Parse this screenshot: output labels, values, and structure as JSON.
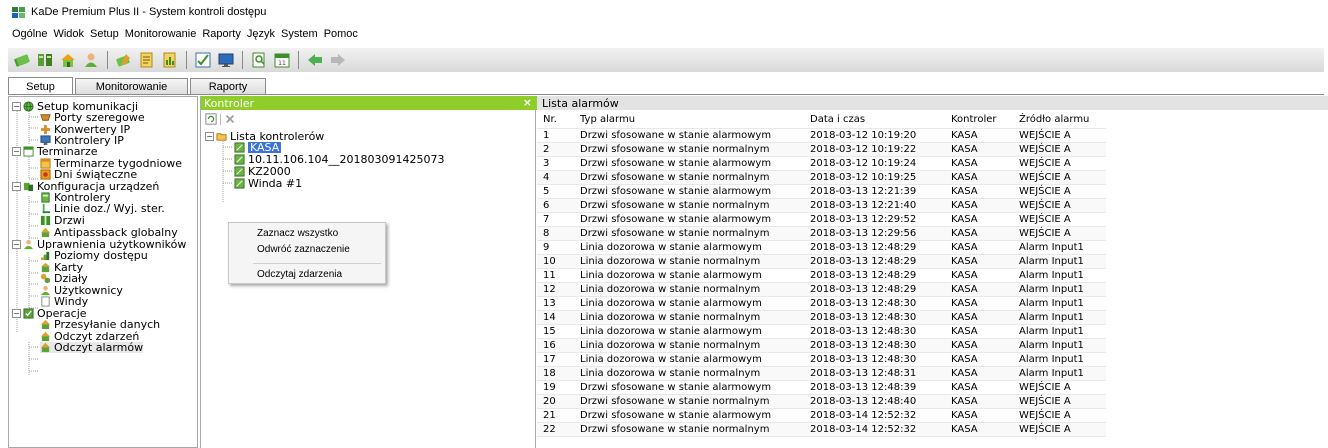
{
  "window": {
    "title": "KaDe Premium Plus II - System kontroli dostępu"
  },
  "menu": [
    "Ogólne",
    "Widok",
    "Setup",
    "Monitorowanie",
    "Raporty",
    "Język",
    "System",
    "Pomoc"
  ],
  "toolbar": {
    "buttons": [
      "cards-icon",
      "controllers-icon",
      "home-icon",
      "user-icon",
      "cards-edit-icon",
      "document-icon",
      "report-icon",
      "checklist-icon",
      "monitor-icon",
      "search-document-icon",
      "calendar-icon",
      "arrow-left-icon",
      "arrow-right-icon"
    ]
  },
  "tabs": [
    "Setup",
    "Monitorowanie",
    "Raporty"
  ],
  "tree": [
    {
      "label": "Setup komunikacji",
      "level": 0,
      "icon": "globe-icon"
    },
    {
      "label": "Porty szeregowe",
      "level": 1,
      "icon": "serial-port-icon"
    },
    {
      "label": "Konwertery IP",
      "level": 1,
      "icon": "converter-icon"
    },
    {
      "label": "Kontrolery IP",
      "level": 1,
      "icon": "ip-controller-icon"
    },
    {
      "label": "Terminarze",
      "level": 0,
      "icon": "schedule-icon"
    },
    {
      "label": "Terminarze tygodniowe",
      "level": 1,
      "icon": "week-calendar-icon"
    },
    {
      "label": "Dni świąteczne",
      "level": 1,
      "icon": "holiday-icon"
    },
    {
      "label": "Konfiguracja urządzeń",
      "level": 0,
      "icon": "devices-icon"
    },
    {
      "label": "Kontrolery",
      "level": 1,
      "icon": "controller-icon"
    },
    {
      "label": "Linie doz./ Wyj. ster.",
      "level": 1,
      "icon": "lines-icon"
    },
    {
      "label": "Drzwi",
      "level": 1,
      "icon": "door-icon"
    },
    {
      "label": "Antipassback globalny",
      "level": 1,
      "icon": "antipassback-icon"
    },
    {
      "label": "Uprawnienia użytkowników",
      "level": 0,
      "icon": "users-icon"
    },
    {
      "label": "Poziomy dostępu",
      "level": 1,
      "icon": "access-level-icon"
    },
    {
      "label": "Karty",
      "level": 1,
      "icon": "card-icon"
    },
    {
      "label": "Działy",
      "level": 1,
      "icon": "departments-icon"
    },
    {
      "label": "Użytkownicy",
      "level": 1,
      "icon": "user-icon"
    },
    {
      "label": "Windy",
      "level": 1,
      "icon": "elevator-icon"
    },
    {
      "label": "Operacje",
      "level": 0,
      "icon": "operations-icon"
    },
    {
      "label": "Przesyłanie danych",
      "level": 1,
      "icon": "transfer-icon"
    },
    {
      "label": "Odczyt zdarzeń",
      "level": 1,
      "icon": "events-icon"
    },
    {
      "label": "Odczyt alarmów",
      "level": 1,
      "icon": "alarms-icon"
    }
  ],
  "controllers_panel": {
    "title": "Kontroler",
    "close": "×",
    "root": "Lista kontrolerów",
    "items": [
      "KASA",
      "10.11.106.104__201803091425073",
      "KZ2000",
      "Winda #1"
    ]
  },
  "context_menu": {
    "items": [
      "Zaznacz wszystko",
      "Odwróć zaznaczenie",
      "Odczytaj zdarzenia"
    ]
  },
  "alarms_panel": {
    "title": "Lista alarmów",
    "columns": [
      "Nr.",
      "Typ alarmu",
      "Data i czas",
      "Kontroler",
      "Źródło alarmu"
    ],
    "rows": [
      [
        "1",
        "Drzwi sfosowane w stanie alarmowym",
        "2018-03-12 10:19:20",
        "KASA",
        "WEJŚCIE A"
      ],
      [
        "2",
        "Drzwi sfosowane w stanie normalnym",
        "2018-03-12 10:19:22",
        "KASA",
        "WEJŚCIE A"
      ],
      [
        "3",
        "Drzwi sfosowane w stanie alarmowym",
        "2018-03-12 10:19:24",
        "KASA",
        "WEJŚCIE A"
      ],
      [
        "4",
        "Drzwi sfosowane w stanie normalnym",
        "2018-03-12 10:19:25",
        "KASA",
        "WEJŚCIE A"
      ],
      [
        "5",
        "Drzwi sfosowane w stanie alarmowym",
        "2018-03-13 12:21:39",
        "KASA",
        "WEJŚCIE A"
      ],
      [
        "6",
        "Drzwi sfosowane w stanie normalnym",
        "2018-03-13 12:21:40",
        "KASA",
        "WEJŚCIE A"
      ],
      [
        "7",
        "Drzwi sfosowane w stanie alarmowym",
        "2018-03-13 12:29:52",
        "KASA",
        "WEJŚCIE A"
      ],
      [
        "8",
        "Drzwi sfosowane w stanie normalnym",
        "2018-03-13 12:29:56",
        "KASA",
        "WEJŚCIE A"
      ],
      [
        "9",
        "Linia dozorowa w stanie alarmowym",
        "2018-03-13 12:48:29",
        "KASA",
        "Alarm Input1"
      ],
      [
        "10",
        "Linia dozorowa w stanie normalnym",
        "2018-03-13 12:48:29",
        "KASA",
        "Alarm Input1"
      ],
      [
        "11",
        "Linia dozorowa w stanie alarmowym",
        "2018-03-13 12:48:29",
        "KASA",
        "Alarm Input1"
      ],
      [
        "12",
        "Linia dozorowa w stanie normalnym",
        "2018-03-13 12:48:29",
        "KASA",
        "Alarm Input1"
      ],
      [
        "13",
        "Linia dozorowa w stanie alarmowym",
        "2018-03-13 12:48:30",
        "KASA",
        "Alarm Input1"
      ],
      [
        "14",
        "Linia dozorowa w stanie normalnym",
        "2018-03-13 12:48:30",
        "KASA",
        "Alarm Input1"
      ],
      [
        "15",
        "Linia dozorowa w stanie alarmowym",
        "2018-03-13 12:48:30",
        "KASA",
        "Alarm Input1"
      ],
      [
        "16",
        "Linia dozorowa w stanie normalnym",
        "2018-03-13 12:48:30",
        "KASA",
        "Alarm Input1"
      ],
      [
        "17",
        "Linia dozorowa w stanie alarmowym",
        "2018-03-13 12:48:30",
        "KASA",
        "Alarm Input1"
      ],
      [
        "18",
        "Linia dozorowa w stanie normalnym",
        "2018-03-13 12:48:31",
        "KASA",
        "Alarm Input1"
      ],
      [
        "19",
        "Drzwi sfosowane w stanie alarmowym",
        "2018-03-13 12:48:39",
        "KASA",
        "WEJŚCIE A"
      ],
      [
        "20",
        "Drzwi sfosowane w stanie normalnym",
        "2018-03-13 12:48:40",
        "KASA",
        "WEJŚCIE A"
      ],
      [
        "21",
        "Drzwi sfosowane w stanie alarmowym",
        "2018-03-14 12:52:32",
        "KASA",
        "WEJŚCIE A"
      ],
      [
        "22",
        "Drzwi sfosowane w stanie normalnym",
        "2018-03-14 12:52:32",
        "KASA",
        "WEJŚCIE A"
      ]
    ]
  },
  "colors": {
    "panel_header_green": "#8fcd2a",
    "selection_blue": "#3b74d6",
    "alarm_header_gray": "#e3e3e3"
  }
}
